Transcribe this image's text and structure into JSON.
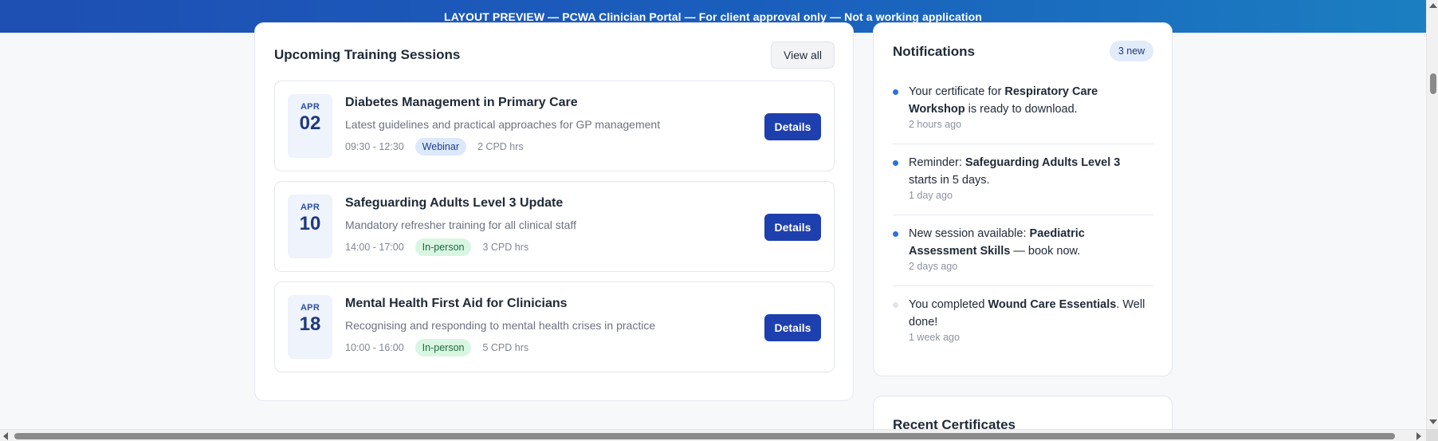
{
  "banner": {
    "text": "LAYOUT PREVIEW — PCWA Clinician Portal — For client approval only — Not a working application"
  },
  "training": {
    "title": "Upcoming Training Sessions",
    "view_all_label": "View all",
    "details_label": "Details",
    "sessions": [
      {
        "month": "APR",
        "day": "02",
        "title": "Diabetes Management in Primary Care",
        "description": "Latest guidelines and practical approaches for GP management",
        "time": "09:30 - 12:30",
        "format": "Webinar",
        "cpd": "2 CPD hrs"
      },
      {
        "month": "APR",
        "day": "10",
        "title": "Safeguarding Adults Level 3 Update",
        "description": "Mandatory refresher training for all clinical staff",
        "time": "14:00 - 17:00",
        "format": "In-person",
        "cpd": "3 CPD hrs"
      },
      {
        "month": "APR",
        "day": "18",
        "title": "Mental Health First Aid for Clinicians",
        "description": "Recognising and responding to mental health crises in practice",
        "time": "10:00 - 16:00",
        "format": "In-person",
        "cpd": "5 CPD hrs"
      }
    ]
  },
  "notifications": {
    "title": "Notifications",
    "badge": "3 new",
    "items": [
      {
        "pre": "Your certificate for ",
        "bold": "Respiratory Care Workshop",
        "post": " is ready to download.",
        "time": "2 hours ago",
        "unread": true
      },
      {
        "pre": "Reminder: ",
        "bold": "Safeguarding Adults Level 3",
        "post": " starts in 5 days.",
        "time": "1 day ago",
        "unread": true
      },
      {
        "pre": "New session available: ",
        "bold": "Paediatric Assessment Skills",
        "post": " — book now.",
        "time": "2 days ago",
        "unread": true
      },
      {
        "pre": "You completed ",
        "bold": "Wound Care Essentials",
        "post": ". Well done!",
        "time": "1 week ago",
        "unread": false
      }
    ]
  },
  "certificates": {
    "title": "Recent Certificates"
  },
  "colors": {
    "accent": "#1e3fae",
    "banner_start": "#1e4fb3",
    "banner_end": "#1b7fc1",
    "unread_dot": "#2f6fe0"
  }
}
